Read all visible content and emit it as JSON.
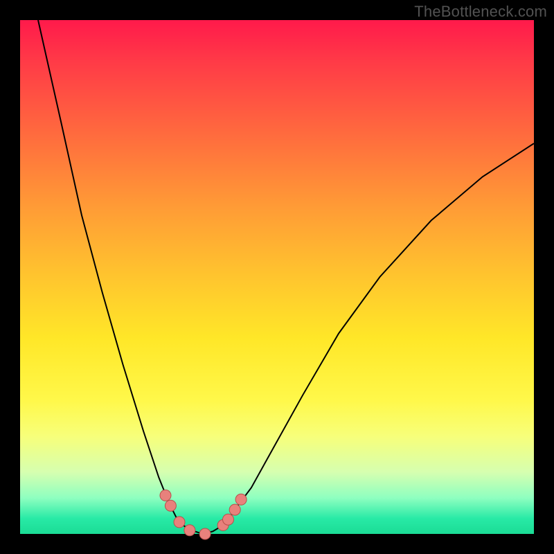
{
  "watermark": "TheBottleneck.com",
  "chart_data": {
    "type": "line",
    "title": "",
    "xlabel": "",
    "ylabel": "",
    "xlim": [
      0,
      1
    ],
    "ylim": [
      0,
      1
    ],
    "series": [
      {
        "name": "curve",
        "x": [
          0.035,
          0.08,
          0.12,
          0.16,
          0.2,
          0.24,
          0.27,
          0.29,
          0.305,
          0.32,
          0.34,
          0.355,
          0.375,
          0.4,
          0.42,
          0.45,
          0.5,
          0.55,
          0.62,
          0.7,
          0.8,
          0.9,
          1.0
        ],
        "y": [
          1.0,
          0.8,
          0.62,
          0.47,
          0.33,
          0.2,
          0.11,
          0.06,
          0.03,
          0.015,
          0.005,
          0.0,
          0.005,
          0.02,
          0.05,
          0.09,
          0.18,
          0.27,
          0.39,
          0.5,
          0.61,
          0.695,
          0.76
        ]
      }
    ],
    "markers": {
      "name": "highlight-points",
      "x": [
        0.283,
        0.293,
        0.31,
        0.33,
        0.36,
        0.395,
        0.405,
        0.418,
        0.43
      ],
      "y": [
        0.075,
        0.055,
        0.023,
        0.007,
        0.0,
        0.017,
        0.028,
        0.047,
        0.067
      ]
    },
    "colors": {
      "curve": "#000000",
      "marker_fill": "#e8817c",
      "marker_stroke": "#b74f4b",
      "background_top": "#ff1a4b",
      "background_mid": "#ffe728",
      "background_bottom": "#1bdc95"
    }
  }
}
